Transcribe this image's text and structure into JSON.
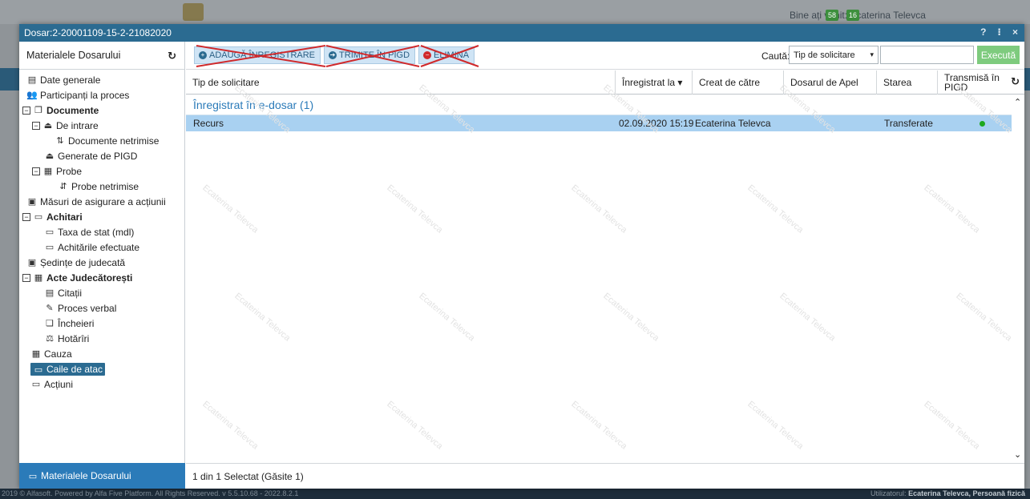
{
  "background": {
    "welcome": "Bine ați venit: Ecaterina Televca",
    "badge_1": "58",
    "badge_2": "16",
    "footer_left": "2019 © Alfasoft. Powered by Alfa Five Platform. All Rights Reserved. v 5.5.10.68 - 2022.8.2.1",
    "footer_user_prefix": "Utilizatorul:",
    "footer_user": "Ecaterina Televca, Persoană fizică"
  },
  "dialog": {
    "title": "Dosar:2-20001109-15-2-21082020",
    "controls": [
      "?",
      "⁝",
      "×"
    ]
  },
  "sidebar": {
    "header": "Materialele Dosarului",
    "footer": "Materialele Dosarului",
    "items": [
      {
        "label": "Date generale",
        "icon": "document-icon",
        "bold": false
      },
      {
        "label": "Participanți la proces",
        "icon": "users-icon",
        "bold": false
      },
      {
        "label": "Documente",
        "icon": "documents-icon",
        "bold": true
      },
      {
        "label": "De intrare",
        "icon": "inbox-icon",
        "bold": false
      },
      {
        "label": "Documente netrimise",
        "icon": "sort-icon",
        "bold": false
      },
      {
        "label": "Generate de PIGD",
        "icon": "inbox-icon",
        "bold": false
      },
      {
        "label": "Probe",
        "icon": "archive-icon",
        "bold": false
      },
      {
        "label": "Probe netrimise",
        "icon": "sort-alt-icon",
        "bold": false
      },
      {
        "label": "Măsuri de asigurare a acțiunii",
        "icon": "calendar-icon",
        "bold": false
      },
      {
        "label": "Achitari",
        "icon": "folder-open-icon",
        "bold": true
      },
      {
        "label": "Taxa de stat (mdl)",
        "icon": "folder-open-icon",
        "bold": false
      },
      {
        "label": "Achitările efectuate",
        "icon": "folder-open-icon",
        "bold": false
      },
      {
        "label": "Ședințe de judecată",
        "icon": "calendar-icon",
        "bold": false
      },
      {
        "label": "Acte Judecătorești",
        "icon": "archive-icon",
        "bold": true
      },
      {
        "label": "Citații",
        "icon": "summons-icon",
        "bold": false
      },
      {
        "label": "Proces verbal",
        "icon": "edit-icon",
        "bold": false
      },
      {
        "label": "Încheieri",
        "icon": "copy-icon",
        "bold": false
      },
      {
        "label": "Hotărîri",
        "icon": "gavel-icon",
        "bold": false
      },
      {
        "label": "Cauza",
        "icon": "archive-icon",
        "bold": false
      },
      {
        "label": "Caile de atac",
        "icon": "folder-open-icon",
        "bold": false
      },
      {
        "label": "Acțiuni",
        "icon": "folder-open-icon",
        "bold": false
      }
    ]
  },
  "toolbar": {
    "add_label": "ADAUGĂ ÎNREGISTRARE",
    "send_label": "TRIMITE ÎN PIGD",
    "delete_label": "ELIMINĂ",
    "search_label": "Caută:",
    "search_select": "Tip de solicitare",
    "search_value": "",
    "run_label": "Execută"
  },
  "table": {
    "columns": [
      "Tip de solicitare",
      "Înregistrat la",
      "Creat de către",
      "Dosarul de Apel",
      "Starea",
      "Transmisă în PIGD"
    ],
    "group_label": "Înregistrat în e-dosar (1)",
    "rows": [
      {
        "type": "Recurs",
        "registered": "02.09.2020 15:19",
        "created_by": "Ecaterina Televca",
        "appeal_case": "",
        "status": "Transferate",
        "sent_pigd": true
      }
    ],
    "status_text": "1 din 1 Selectat (Găsite 1)"
  },
  "watermark": "Ecaterina Televca",
  "colors": {
    "title_bar": "#2b6b91",
    "accent": "#2b7bb9",
    "selected_row": "#a9d1f1",
    "run_button": "#7ecb7e",
    "strike": "#d0292b",
    "status_ok": "#1ea81e"
  }
}
